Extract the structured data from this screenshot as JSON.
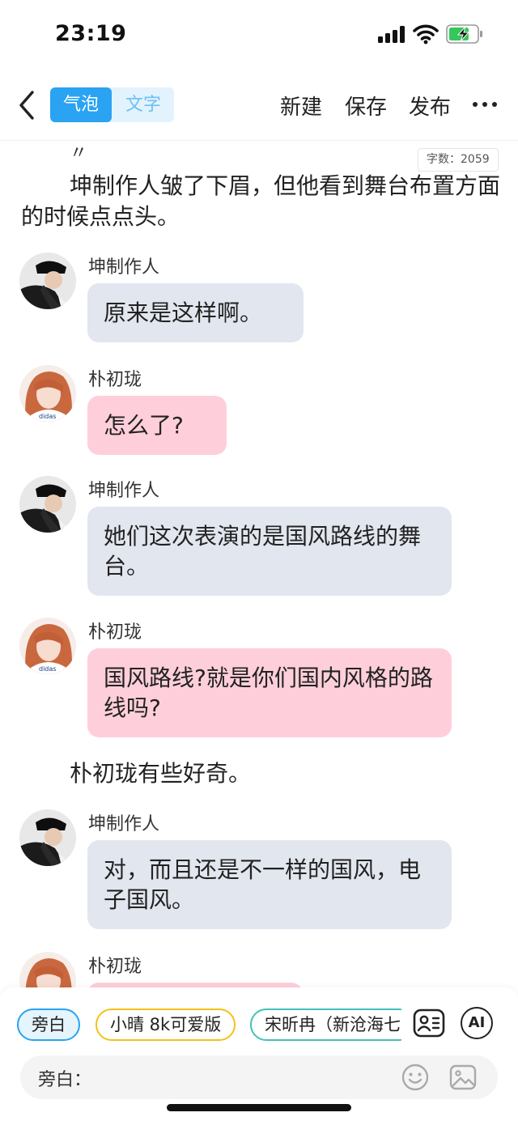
{
  "status_bar": {
    "time": "23:19",
    "icons": [
      "cellular-signal-icon",
      "wifi-icon",
      "battery-charging-icon"
    ]
  },
  "nav": {
    "back_icon": "chevron-left-icon",
    "segment": [
      "气泡",
      "文字"
    ],
    "active_segment": "气泡",
    "actions": {
      "new": "新建",
      "save": "保存",
      "publish": "发布"
    },
    "more_icon": "more-dots-icon"
  },
  "content": {
    "quote_mark": "〃",
    "word_count": "字数：2059",
    "intro_narration": "坤制作人皱了下眉，但他看到舞台布置方面的时候点点头。",
    "mid_narration": "朴初珑有些好奇。",
    "messages": [
      {
        "speaker": "坤制作人",
        "text": "原来是这样啊。",
        "style": "gray"
      },
      {
        "speaker": "朴初珑",
        "text": "怎么了?",
        "style": "pink"
      },
      {
        "speaker": "坤制作人",
        "text": "她们这次表演的是国风路线的舞台。",
        "style": "gray"
      },
      {
        "speaker": "朴初珑",
        "text": "国风路线?就是你们国内风格的路线吗?",
        "style": "pink"
      },
      {
        "speaker": "坤制作人",
        "text": "对，而且还是不一样的国风，电子国风。",
        "style": "gray"
      },
      {
        "speaker": "朴初珑",
        "text": "",
        "style": "pink"
      }
    ]
  },
  "bottom": {
    "chips": [
      "旁白",
      "小晴 8k可爱版",
      "宋昕冉（新沧海七"
    ],
    "selected_chip": "旁白",
    "tools": {
      "character_icon": "character-card-icon",
      "ai_label": "AI"
    },
    "input_label": "旁白：",
    "input_value": "",
    "input_icons": [
      "emoji-icon",
      "image-icon"
    ]
  },
  "colors": {
    "accent": "#2aa3f2",
    "bubble_gray": "#e2e6ee",
    "bubble_pink": "#fecfda",
    "chip_yellow": "#f2c21b",
    "chip_teal": "#43c0b8"
  }
}
